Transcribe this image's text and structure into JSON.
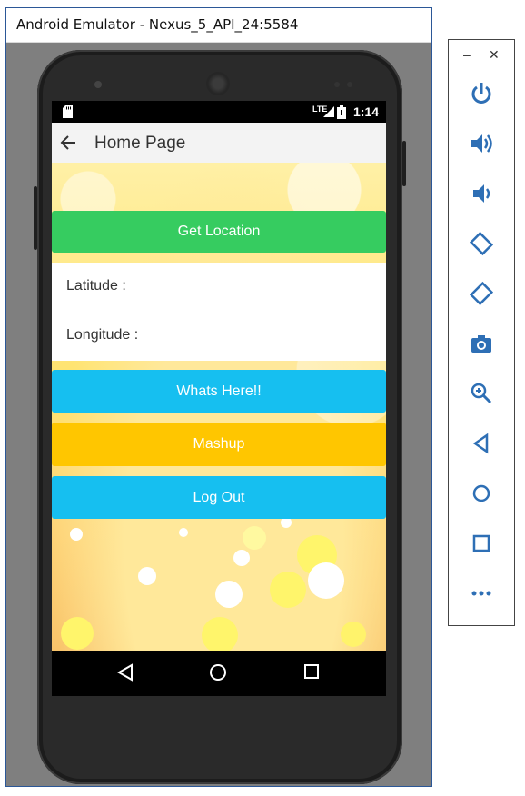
{
  "window": {
    "title": "Android Emulator - Nexus_5_API_24:5584"
  },
  "status_bar": {
    "network": "LTE",
    "time": "1:14"
  },
  "app_bar": {
    "title": "Home Page"
  },
  "main": {
    "get_location_label": "Get Location",
    "latitude_label": "Latitude :",
    "longitude_label": "Longitude :",
    "whats_here_label": "Whats Here!!",
    "mashup_label": "Mashup",
    "logout_label": "Log Out"
  },
  "colors": {
    "get_location": "#36cc60",
    "whats_here": "#16bff0",
    "mashup": "#ffc600",
    "logout": "#16bff0"
  },
  "toolbar": {
    "items": [
      "power-icon",
      "volume-up-icon",
      "volume-down-icon",
      "rotate-left-icon",
      "rotate-right-icon",
      "camera-icon",
      "zoom-icon",
      "back-icon",
      "home-icon",
      "overview-icon",
      "more-icon"
    ]
  },
  "nav": {
    "items": [
      "back-icon",
      "home-icon",
      "overview-icon"
    ]
  }
}
